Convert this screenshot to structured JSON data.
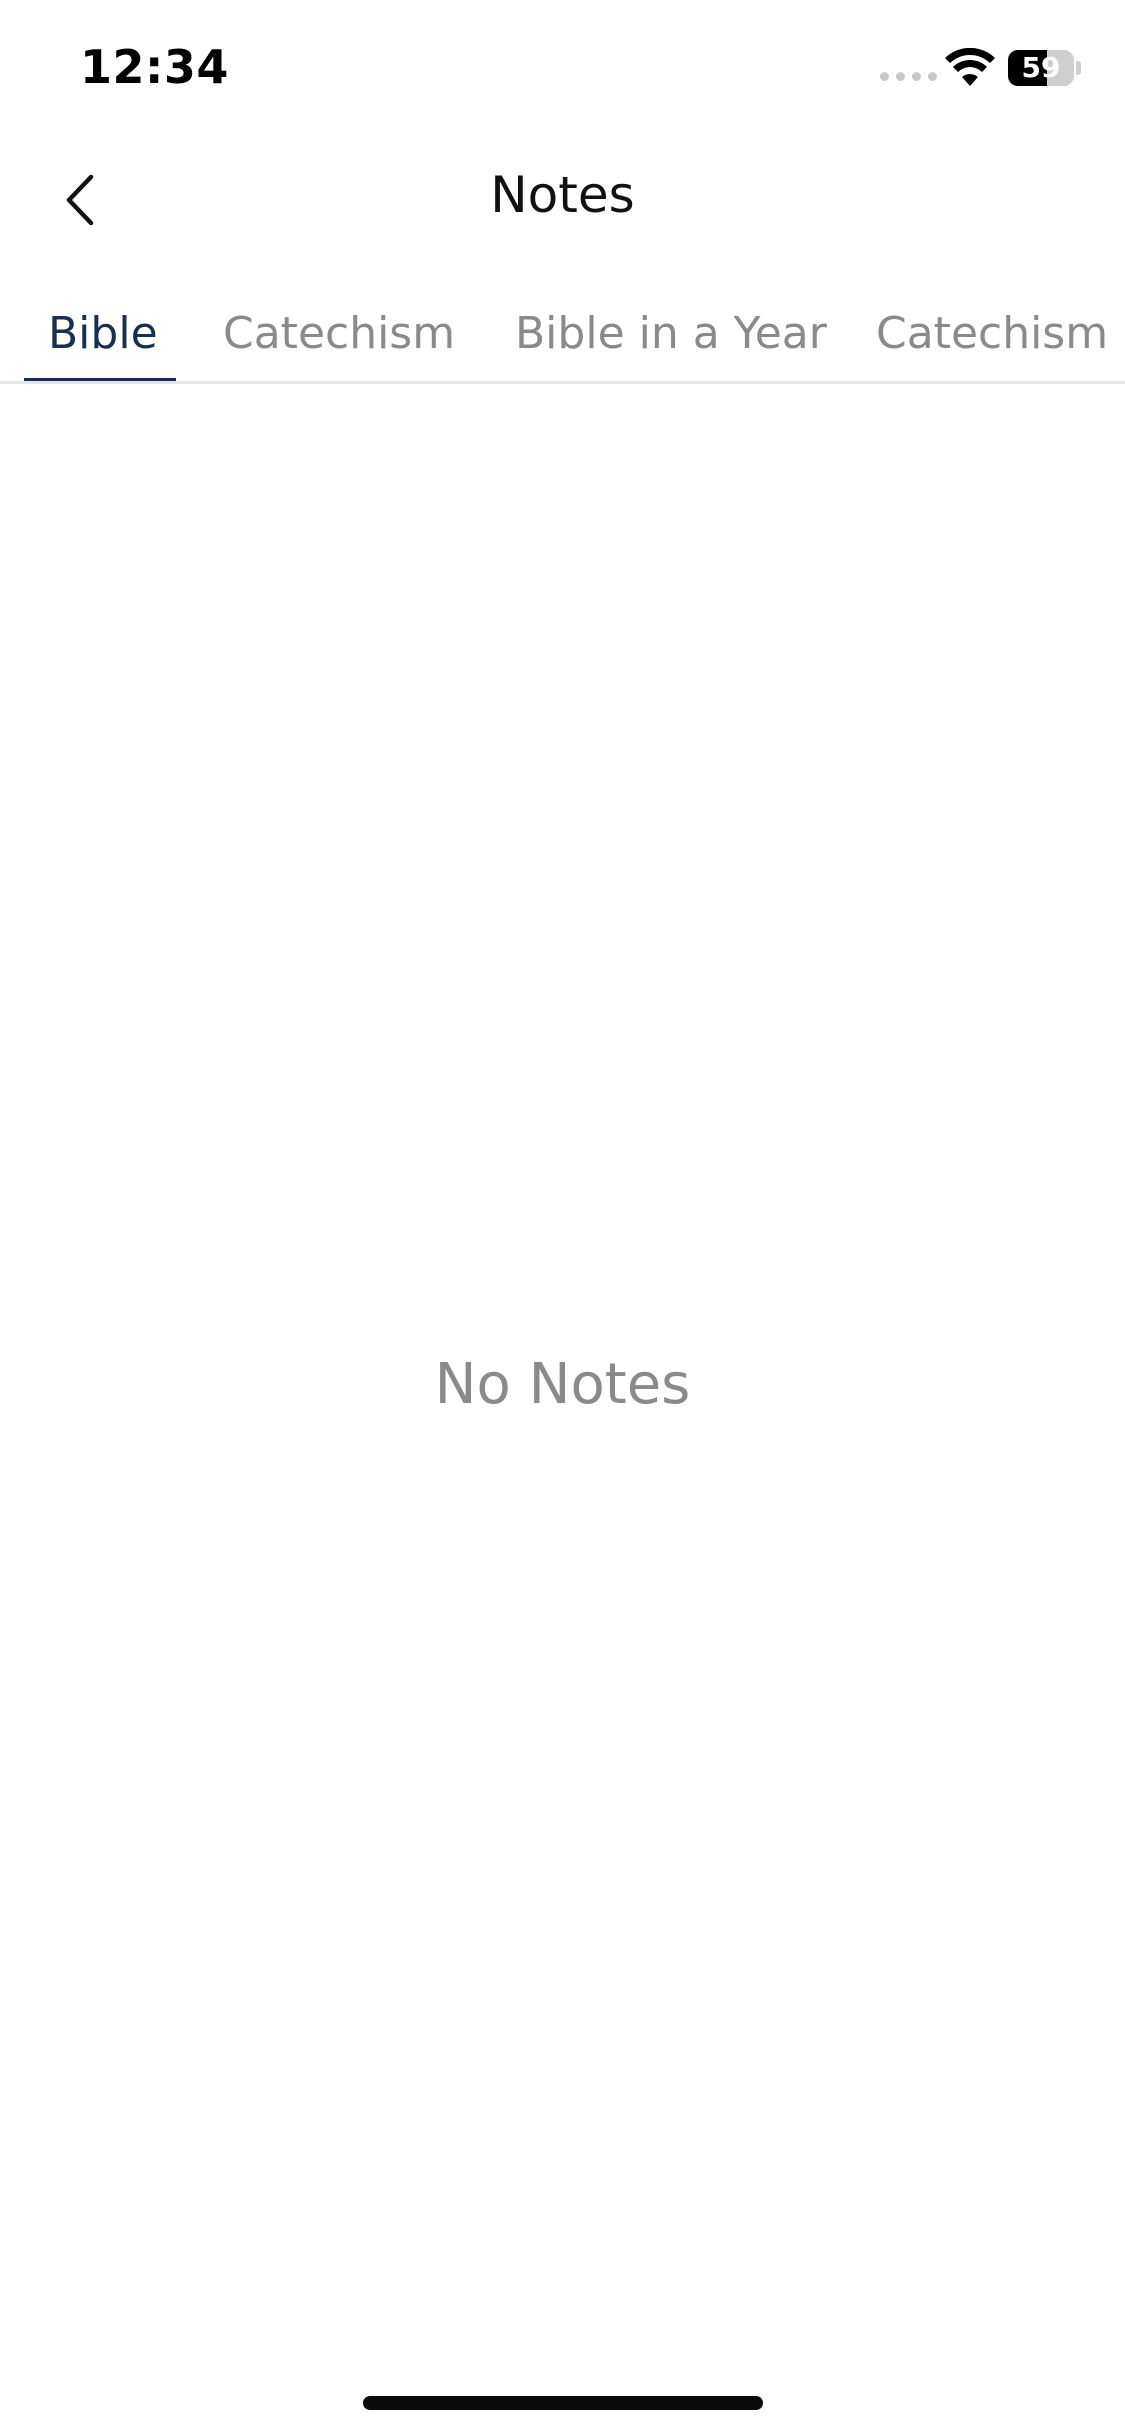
{
  "status_bar": {
    "time": "12:34",
    "battery_level": "59",
    "battery_fraction": 0.59,
    "icons": [
      "signal-dots-icon",
      "wifi-icon",
      "battery-icon"
    ]
  },
  "nav": {
    "back_icon": "chevron-left-icon",
    "title": "Notes"
  },
  "tabs": [
    {
      "label": "Bible",
      "active": true
    },
    {
      "label": "Catechism",
      "active": false
    },
    {
      "label": "Bible in a Year",
      "active": false
    },
    {
      "label": "Catechism in",
      "active": false
    }
  ],
  "empty_state": {
    "message": "No Notes"
  },
  "colors": {
    "active_tab": "#1a2f4f",
    "inactive_tab": "#8a8a8a",
    "background": "#ffffff"
  }
}
